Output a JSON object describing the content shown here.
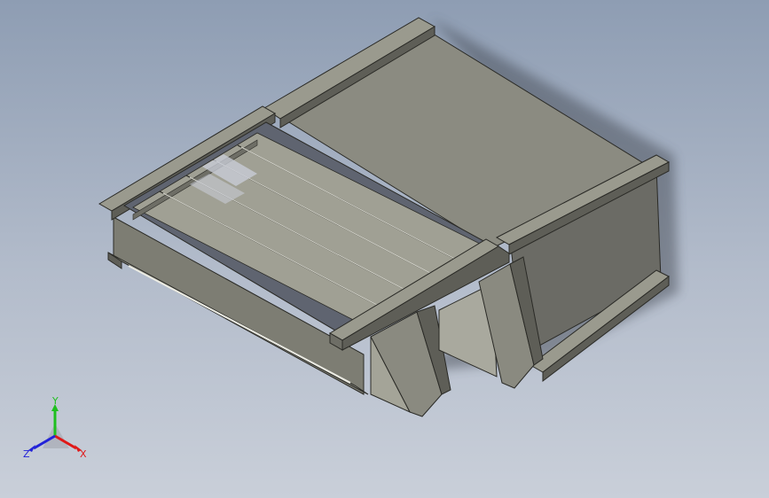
{
  "viewport": {
    "background_top": "#8e9db3",
    "background_bottom": "#c9cfd9"
  },
  "model": {
    "face_light": "#9c9c90",
    "face_mid": "#8a8a80",
    "face_dark": "#5c5c56",
    "edge": "#2a2a26"
  },
  "triad": {
    "x_label": "X",
    "y_label": "Y",
    "z_label": "Z",
    "x_color": "#e01818",
    "y_color": "#1fbf1f",
    "z_color": "#2222d8"
  }
}
